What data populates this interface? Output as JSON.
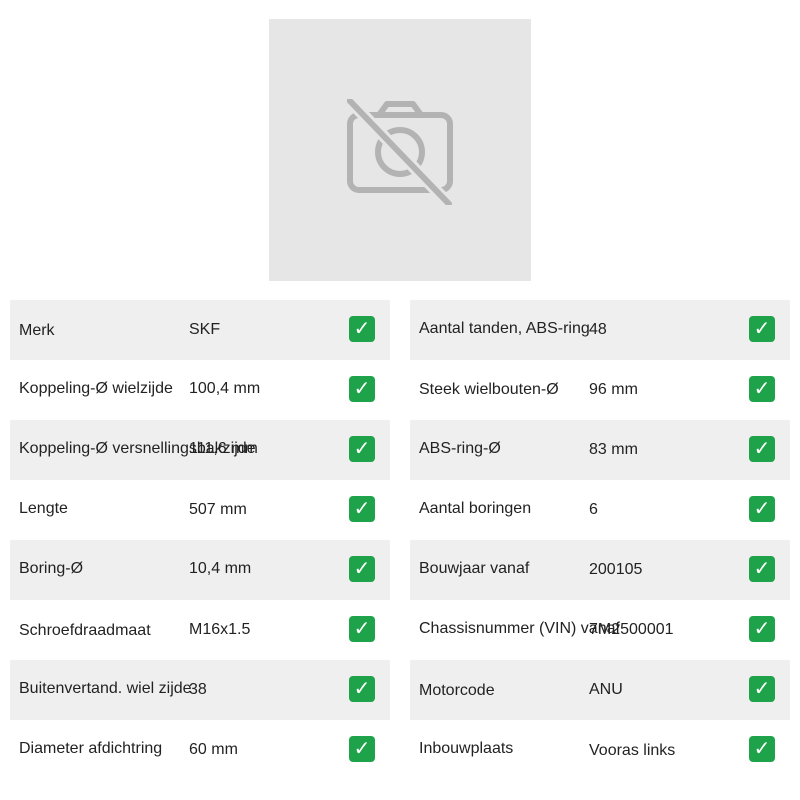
{
  "image_placeholder": {
    "icon": "no-photo-icon",
    "background": "#e6e6e6",
    "icon_color": "#b3b3b3"
  },
  "colors": {
    "row_shade": "#efefef",
    "check_bg": "#1fa34a"
  },
  "check_icon": "check-icon",
  "left_specs": [
    {
      "label": "Merk",
      "value": "SKF"
    },
    {
      "label": "Koppeling-Ø wielzijde",
      "value": "100,4 mm"
    },
    {
      "label": "Koppeling-Ø versnellingsbakzijde",
      "value": "111,6 mm"
    },
    {
      "label": "Lengte",
      "value": "507 mm"
    },
    {
      "label": "Boring-Ø",
      "value": "10,4 mm"
    },
    {
      "label": "Schroefdraadmaat",
      "value": "M16x1.5"
    },
    {
      "label": "Buitenvertand. wiel zijde",
      "value": "38"
    },
    {
      "label": "Diameter afdichtring",
      "value": "60 mm"
    }
  ],
  "right_specs": [
    {
      "label": "Aantal tanden, ABS-ring",
      "value": "48"
    },
    {
      "label": "Steek wielbouten-Ø",
      "value": "96 mm"
    },
    {
      "label": "ABS-ring-Ø",
      "value": "83 mm"
    },
    {
      "label": "Aantal boringen",
      "value": "6"
    },
    {
      "label": "Bouwjaar vanaf",
      "value": "200105"
    },
    {
      "label": "Chassisnummer (VIN) vanaf",
      "value": "7M2500001"
    },
    {
      "label": "Motorcode",
      "value": "ANU"
    },
    {
      "label": "Inbouwplaats",
      "value": "Vooras links"
    }
  ]
}
